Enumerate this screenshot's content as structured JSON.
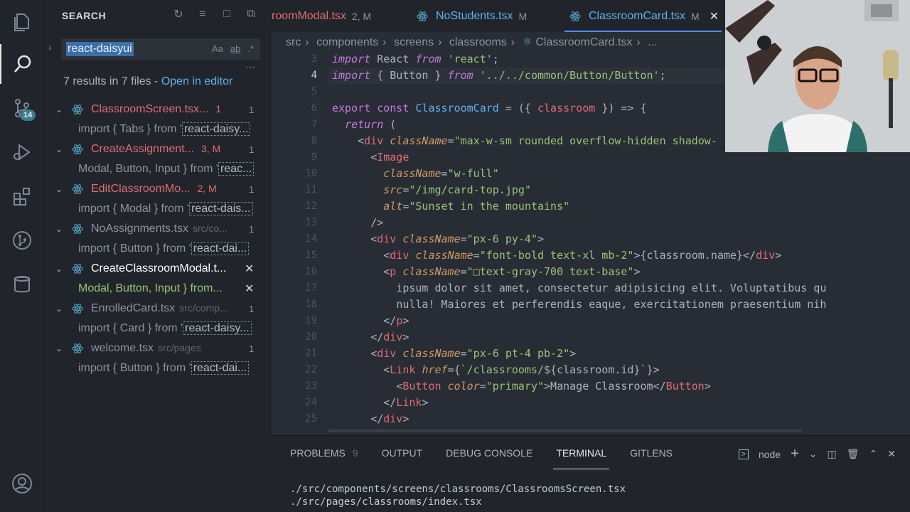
{
  "activity_bar": {
    "items": [
      {
        "icon": "files-icon"
      },
      {
        "icon": "search-icon",
        "active": true
      },
      {
        "icon": "source-control-icon",
        "badge": "14"
      },
      {
        "icon": "run-debug-icon"
      },
      {
        "icon": "extensions-icon"
      },
      {
        "icon": "gitlens-icon"
      },
      {
        "icon": "database-icon"
      },
      {
        "icon": "account-icon"
      }
    ]
  },
  "sidebar": {
    "title": "SEARCH",
    "search_value": "react-daisyui",
    "search_options": [
      "Aa",
      "ab",
      ".*"
    ],
    "results_summary": "7 results in 7 files - ",
    "open_in_editor": "Open in editor",
    "results": [
      {
        "file": "ClassroomScreen.tsx...",
        "status": "1",
        "count": "1",
        "modified": true,
        "match_prefix": "import { Tabs } from '",
        "match_hl": "react-daisy..."
      },
      {
        "file": "CreateAssignment...",
        "status": "3, M",
        "count": "1",
        "modified": true,
        "match_prefix": "Modal, Button, Input } from '",
        "match_hl": "reac..."
      },
      {
        "file": "EditClassroomMo...",
        "status": "2, M",
        "count": "1",
        "modified": true,
        "match_prefix": "import { Modal } from '",
        "match_hl": "react-dais..."
      },
      {
        "file": "NoAssignments.tsx",
        "path": "src/co...",
        "count": "1",
        "modified": false,
        "match_prefix": "import { Button } from '",
        "match_hl": "react-dai..."
      },
      {
        "file": "CreateClassroomModal.t...",
        "count": "",
        "modified": false,
        "selected": true,
        "match_prefix": "Modal, Button, Input } from...",
        "match_hl": ""
      },
      {
        "file": "EnrolledCard.tsx",
        "path": "src/comp...",
        "count": "1",
        "modified": false,
        "match_prefix": "import { Card } from '",
        "match_hl": "react-daisy..."
      },
      {
        "file": "welcome.tsx",
        "path": "src/pages",
        "count": "1",
        "modified": false,
        "match_prefix": "import { Button } from '",
        "match_hl": "react-dai..."
      }
    ]
  },
  "tabs": [
    {
      "label": "roomModal.tsx",
      "status": "2, M",
      "modified": true
    },
    {
      "label": "NoStudents.tsx",
      "status": "M",
      "modified": false
    },
    {
      "label": "ClassroomCard.tsx",
      "status": "M",
      "active": true
    }
  ],
  "breadcrumb": [
    "src",
    "components",
    "screens",
    "classrooms",
    "ClassroomCard.tsx",
    "..."
  ],
  "code_lines": [
    {
      "n": "3",
      "html": "<span class='k'>import</span> <span class='p'>React</span> <span class='k'>from</span> <span class='s'>'react'</span><span class='p'>;</span>"
    },
    {
      "n": "4",
      "html": "<span class='k'>import</span> <span class='p'>{ Button }</span> <span class='k'>from</span> <span class='s'>'../../common/Button/Button'</span><span class='p'>;</span>",
      "current": true
    },
    {
      "n": "5",
      "html": ""
    },
    {
      "n": "6",
      "html": "<span class='kw'>export</span> <span class='kw'>const</span> <span class='f'>ClassroomCard</span> <span class='p'>= ({</span> <span class='v'>classroom</span> <span class='p'>}) =&gt; {</span>"
    },
    {
      "n": "7",
      "html": "  <span class='k'>return</span> <span class='p'>(</span>"
    },
    {
      "n": "8",
      "html": "    <span class='p'>&lt;</span><span class='t'>div</span> <span class='a'>className</span><span class='p'>=</span><span class='s'>\"max-w-sm rounded overflow-hidden shadow-</span>"
    },
    {
      "n": "9",
      "html": "      <span class='p'>&lt;</span><span class='t'>Image</span>"
    },
    {
      "n": "10",
      "html": "        <span class='a'>className</span><span class='p'>=</span><span class='s'>\"w-full\"</span>"
    },
    {
      "n": "11",
      "html": "        <span class='a'>src</span><span class='p'>=</span><span class='s'>\"/img/card-top.jpg\"</span>"
    },
    {
      "n": "12",
      "html": "        <span class='a'>alt</span><span class='p'>=</span><span class='s'>\"Sunset in the mountains\"</span>"
    },
    {
      "n": "13",
      "html": "      <span class='p'>/&gt;</span>"
    },
    {
      "n": "14",
      "html": "      <span class='p'>&lt;</span><span class='t'>div</span> <span class='a'>className</span><span class='p'>=</span><span class='s'>\"px-6 py-4\"</span><span class='p'>&gt;</span>"
    },
    {
      "n": "15",
      "html": "        <span class='p'>&lt;</span><span class='t'>div</span> <span class='a'>className</span><span class='p'>=</span><span class='s'>\"font-bold text-xl mb-2\"</span><span class='p'>&gt;{classroom.name}&lt;/</span><span class='t'>div</span><span class='p'>&gt;</span>"
    },
    {
      "n": "16",
      "html": "        <span class='p'>&lt;</span><span class='t'>p</span> <span class='a'>className</span><span class='p'>=</span><span class='s'>\"&#9633;text-gray-700 text-base\"</span><span class='p'>&gt;</span>"
    },
    {
      "n": "17",
      "html": "          <span class='p'>ipsum dolor sit amet, consectetur adipisicing elit. Voluptatibus qu</span>"
    },
    {
      "n": "18",
      "html": "          <span class='p'>nulla! Maiores et perferendis eaque, exercitationem praesentium nih</span>"
    },
    {
      "n": "19",
      "html": "        <span class='p'>&lt;/</span><span class='t'>p</span><span class='p'>&gt;</span>"
    },
    {
      "n": "20",
      "html": "      <span class='p'>&lt;/</span><span class='t'>div</span><span class='p'>&gt;</span>"
    },
    {
      "n": "21",
      "html": "      <span class='p'>&lt;</span><span class='t'>div</span> <span class='a'>className</span><span class='p'>=</span><span class='s'>\"px-6 pt-4 pb-2\"</span><span class='p'>&gt;</span>"
    },
    {
      "n": "22",
      "html": "        <span class='p'>&lt;</span><span class='t'>Link</span> <span class='a'>href</span><span class='p'>={</span><span class='s'>`/classrooms/</span><span class='p'>${classroom.id}</span><span class='s'>`</span><span class='p'>}&gt;</span>"
    },
    {
      "n": "23",
      "html": "          <span class='p'>&lt;</span><span class='t'>Button</span> <span class='a'>color</span><span class='p'>=</span><span class='s'>\"primary\"</span><span class='p'>&gt;Manage Classroom&lt;/</span><span class='t'>Button</span><span class='p'>&gt;</span>"
    },
    {
      "n": "24",
      "html": "        <span class='p'>&lt;/</span><span class='t'>Link</span><span class='p'>&gt;</span>"
    },
    {
      "n": "25",
      "html": "      <span class='p'>&lt;/</span><span class='t'>div</span><span class='p'>&gt;</span>"
    }
  ],
  "panel": {
    "tabs": [
      {
        "label": "PROBLEMS",
        "count": "9"
      },
      {
        "label": "OUTPUT"
      },
      {
        "label": "DEBUG CONSOLE"
      },
      {
        "label": "TERMINAL",
        "active": true
      },
      {
        "label": "GITLENS"
      }
    ],
    "terminal_name": "node",
    "terminal_lines": [
      "./src/components/screens/classrooms/ClassroomsScreen.tsx",
      "./src/pages/classrooms/index.tsx"
    ]
  }
}
